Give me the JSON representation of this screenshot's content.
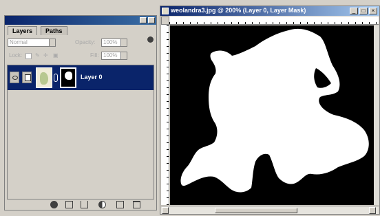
{
  "layers_palette": {
    "tabs": [
      {
        "label": "Layers",
        "active": true
      },
      {
        "label": "Paths",
        "active": false
      }
    ],
    "blend_mode": "Normal",
    "opacity_label": "Opacity:",
    "opacity_value": "100%",
    "lock_label": "Lock:",
    "fill_label": "Fill:",
    "fill_value": "100%",
    "layer": {
      "name": "Layer 0",
      "selected": true
    },
    "bottom_icons": [
      "layer-style-icon",
      "add-mask-icon",
      "new-set-icon",
      "adjustment-layer-icon",
      "new-layer-icon",
      "trash-icon"
    ]
  },
  "document": {
    "title": "weolandra3.jpg @ 200% (Layer 0, Layer Mask)",
    "window_buttons": [
      "_",
      "□",
      "×"
    ]
  },
  "colors": {
    "titlebar": "#0a246a",
    "selection": "#0a246a",
    "chrome": "#d4d0c8",
    "mask_black": "#000000",
    "mask_white": "#ffffff"
  }
}
